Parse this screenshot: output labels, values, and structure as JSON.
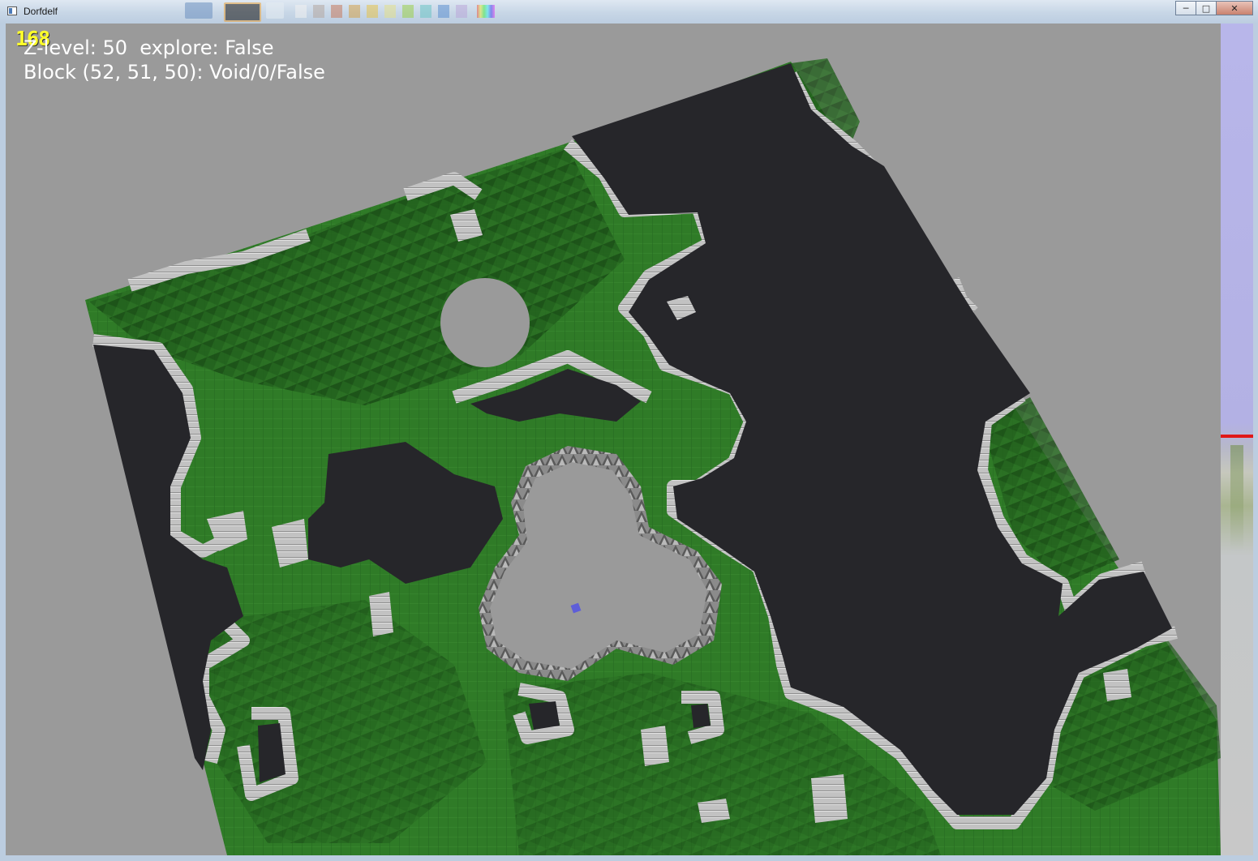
{
  "window": {
    "title": "Dorfdelf",
    "controls": [
      "minimize",
      "maximize",
      "close"
    ]
  },
  "hud": {
    "fps": "168",
    "line1": "Z-level: 50  explore: False",
    "line2": "Block (52, 51, 50): Void/0/False"
  },
  "zlevel_slider": {
    "current_level": 50,
    "position_fraction": 0.494,
    "marker_color": "#e01818"
  },
  "colors": {
    "sky": "#9a9a9a",
    "void": "#26262a",
    "grass": "#2f7a26",
    "grass_dark": "#1f5a1a",
    "stone": "#bdbdbd",
    "cursor": "#5e5ed8"
  }
}
